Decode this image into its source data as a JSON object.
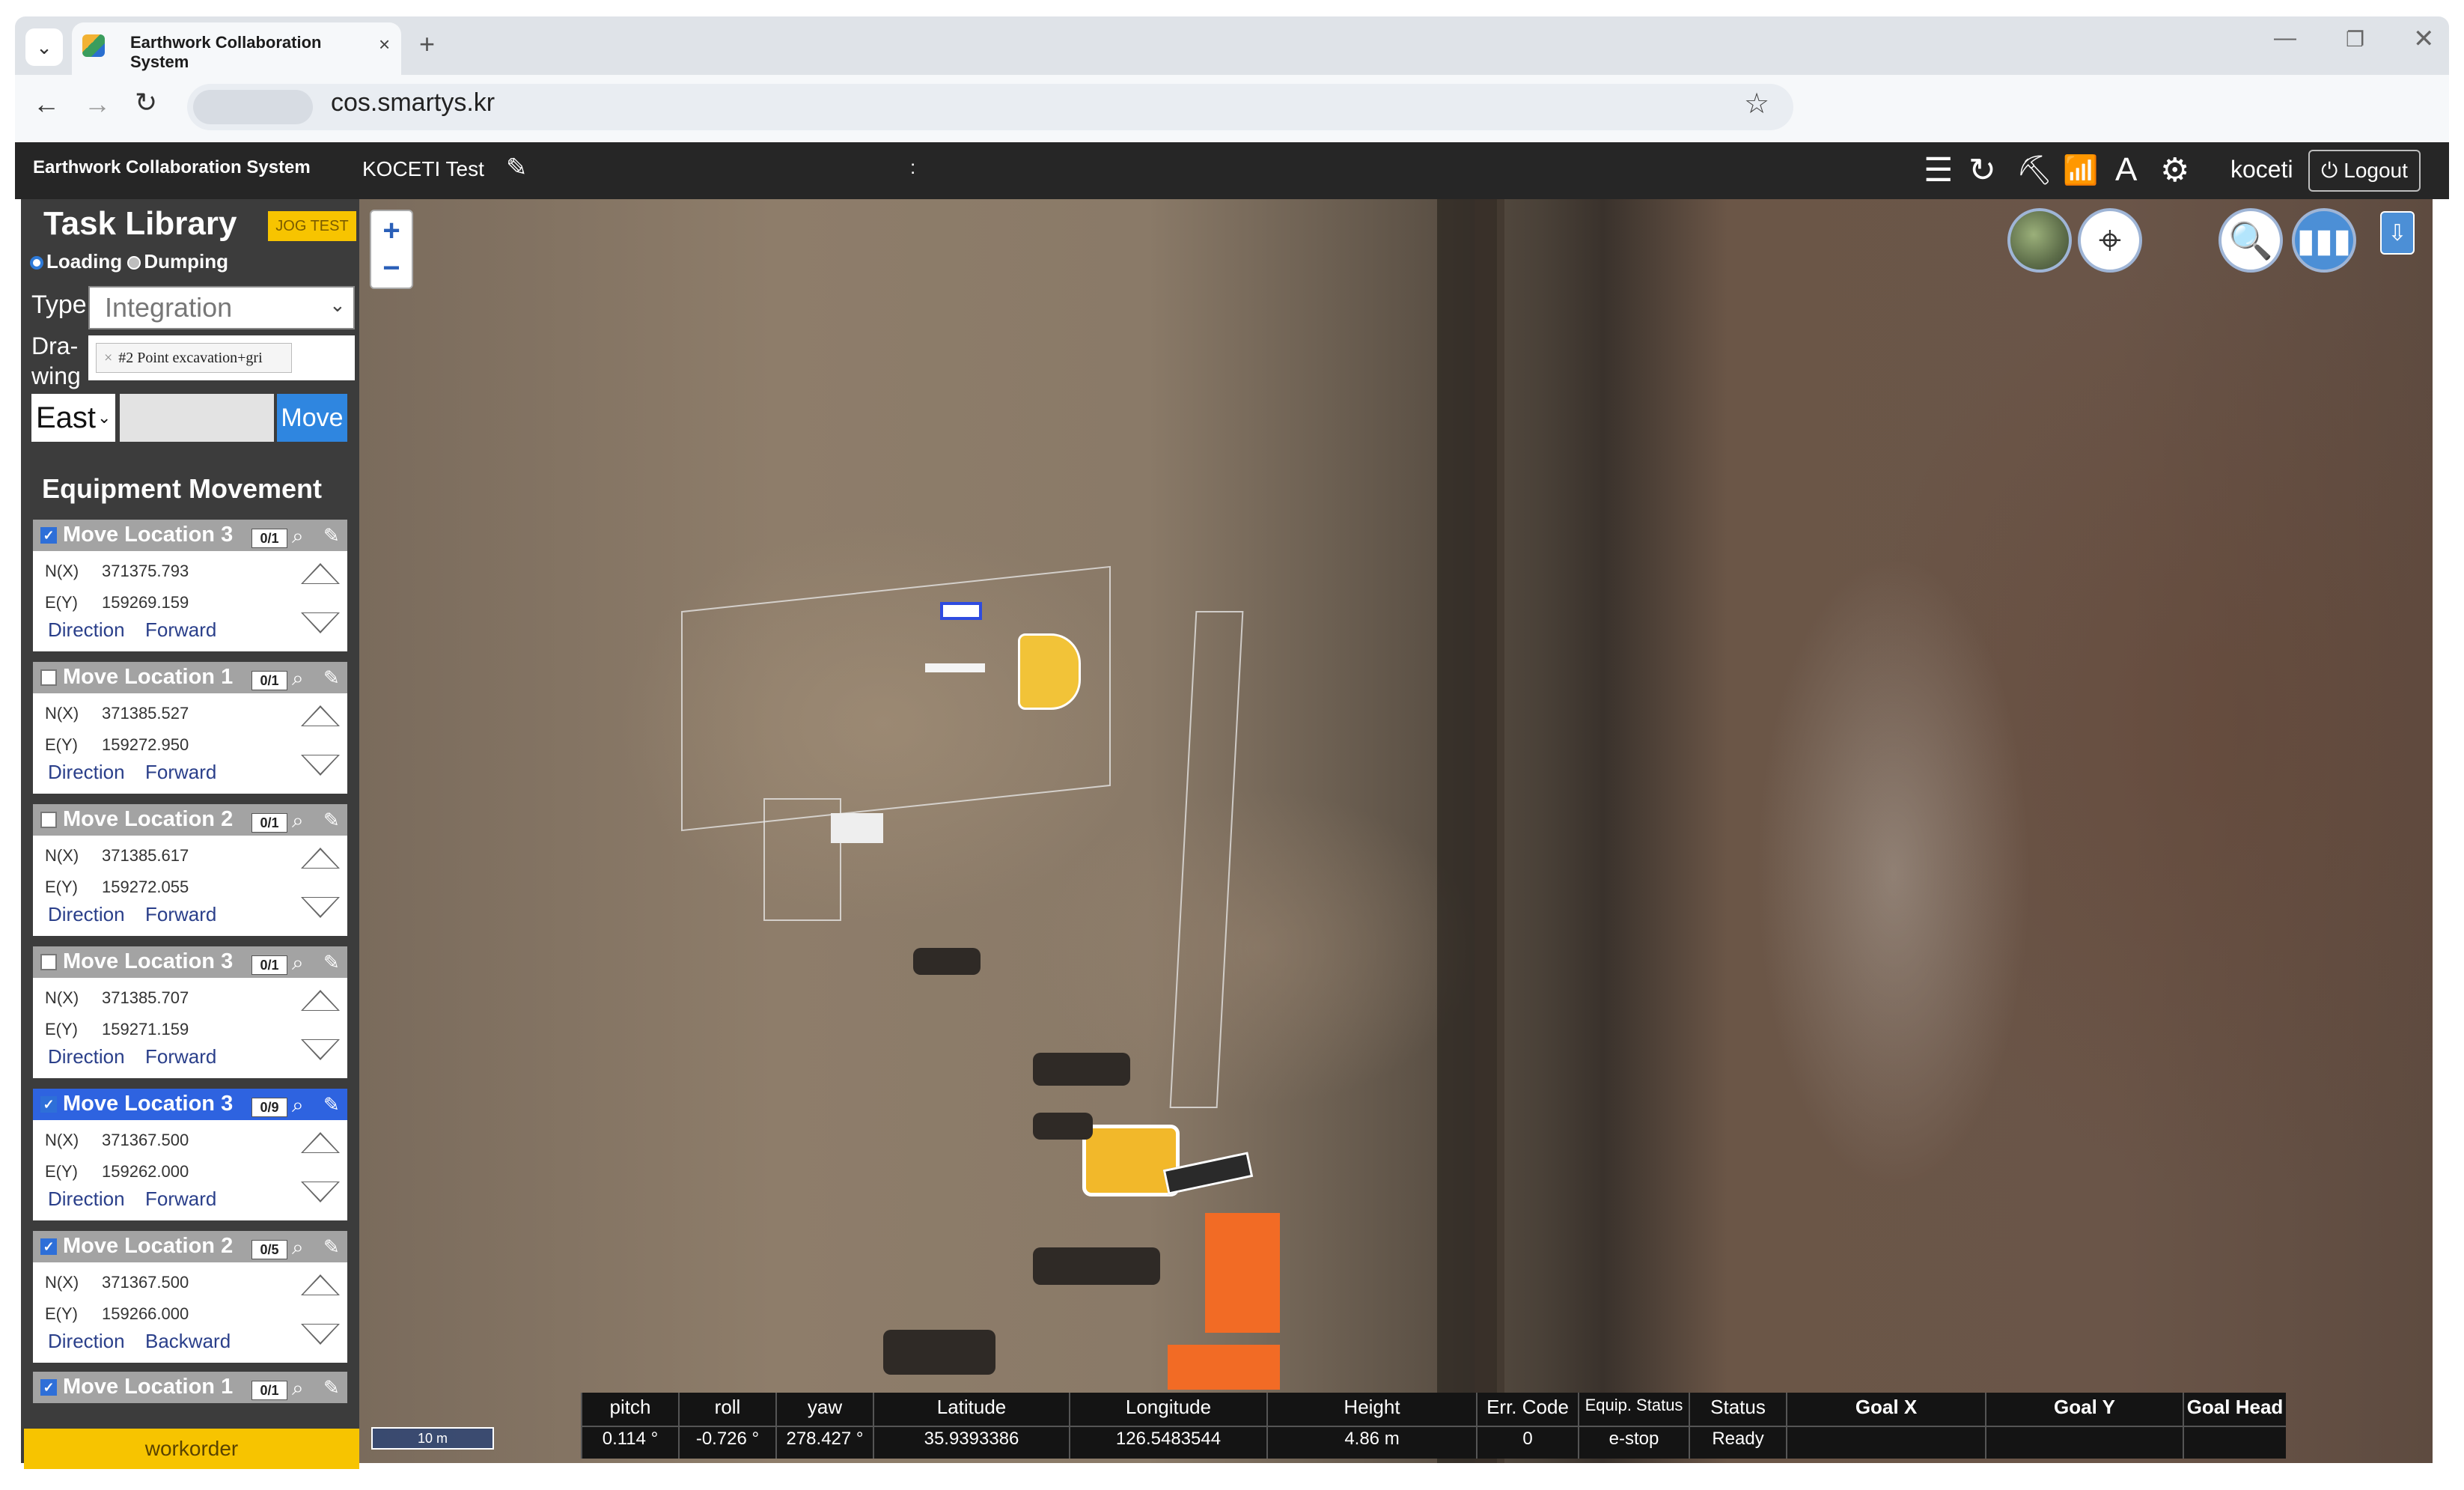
{
  "browser": {
    "tab_title": "Earthwork Collaboration System",
    "url": "cos.smartys.kr",
    "tab_close": "×",
    "new_tab": "+"
  },
  "app": {
    "name": "Earthwork Collaboration System",
    "project": "KOCETI Test",
    "separator": ":",
    "user": "koceti",
    "logout_label": "Logout"
  },
  "task_library": {
    "title": "Task Library",
    "jog_test_label": "JOG TEST",
    "mode_options": [
      "Loading",
      "Dumping"
    ],
    "selected_mode": "Loading",
    "type_label": "Type",
    "type_value": "Integration",
    "drawing_label": "Dra-wing",
    "drawing_value": "#2 Point excavation+gri",
    "direction_value": "East",
    "direction_input": "",
    "move_label": "Move"
  },
  "equipment_movement": {
    "title": "Equipment Movement",
    "n_label": "N(X)",
    "e_label": "E(Y)",
    "direction_label": "Direction",
    "items": [
      {
        "name": "Move Location 3",
        "count": "0/1",
        "checked": true,
        "active": false,
        "n": "371375.793",
        "e": "159269.159",
        "direction": "Forward"
      },
      {
        "name": "Move Location 1",
        "count": "0/1",
        "checked": false,
        "active": false,
        "n": "371385.527",
        "e": "159272.950",
        "direction": "Forward"
      },
      {
        "name": "Move Location 2",
        "count": "0/1",
        "checked": false,
        "active": false,
        "n": "371385.617",
        "e": "159272.055",
        "direction": "Forward"
      },
      {
        "name": "Move Location 3",
        "count": "0/1",
        "checked": false,
        "active": false,
        "n": "371385.707",
        "e": "159271.159",
        "direction": "Forward"
      },
      {
        "name": "Move Location 3",
        "count": "0/9",
        "checked": true,
        "active": true,
        "n": "371367.500",
        "e": "159262.000",
        "direction": "Forward"
      },
      {
        "name": "Move Location 2",
        "count": "0/5",
        "checked": true,
        "active": false,
        "n": "371367.500",
        "e": "159266.000",
        "direction": "Backward"
      },
      {
        "name": "Move Location 1",
        "count": "0/1",
        "checked": true,
        "active": false
      }
    ],
    "workorder_label": "workorder"
  },
  "map": {
    "scale_label": "10 m",
    "zoom_in": "+",
    "zoom_out": "−"
  },
  "status_table": {
    "columns": [
      {
        "header": "pitch",
        "value": "0.114 °"
      },
      {
        "header": "roll",
        "value": "-0.726 °"
      },
      {
        "header": "yaw",
        "value": "278.427 °"
      },
      {
        "header": "Latitude",
        "value": "35.9393386"
      },
      {
        "header": "Longitude",
        "value": "126.5483544"
      },
      {
        "header": "Height",
        "value": "4.86 m"
      },
      {
        "header": "Err. Code",
        "value": "0"
      },
      {
        "header": "Equip. Status",
        "value": "e-stop"
      },
      {
        "header": "Status",
        "value": "Ready"
      },
      {
        "header": "Goal X",
        "value": ""
      },
      {
        "header": "Goal Y",
        "value": ""
      },
      {
        "header": "Goal Head",
        "value": ""
      }
    ]
  },
  "colors": {
    "accent_yellow": "#f7c400",
    "active_blue": "#2e63e0",
    "move_button": "#2f86e0"
  }
}
